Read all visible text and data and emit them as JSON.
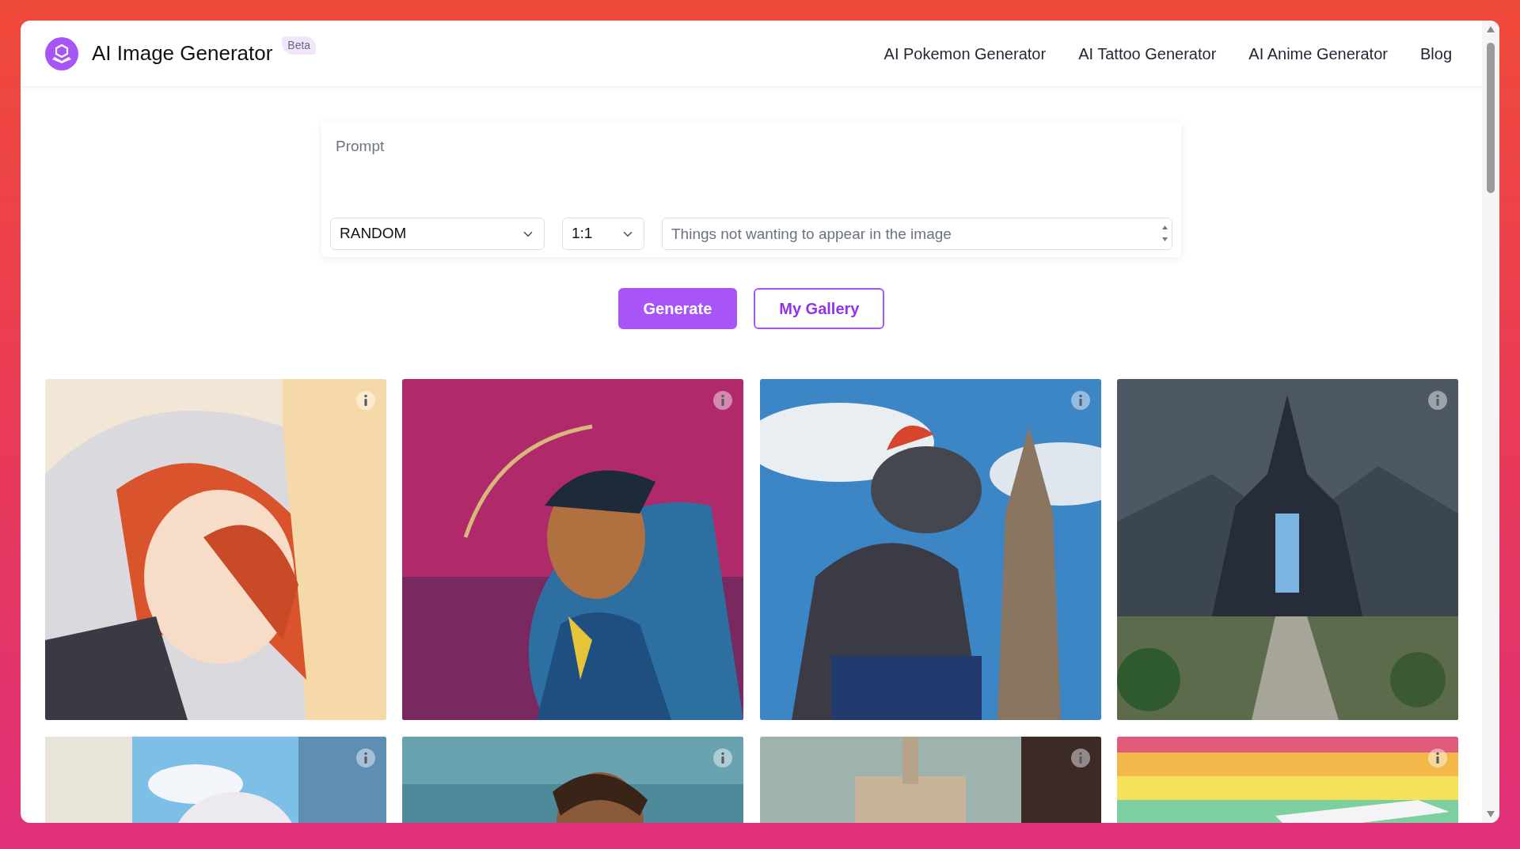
{
  "header": {
    "title": "AI Image Generator",
    "badge": "Beta",
    "nav": [
      "AI Pokemon Generator",
      "AI Tattoo Generator",
      "AI Anime Generator",
      "Blog"
    ]
  },
  "form": {
    "prompt": {
      "placeholder": "Prompt"
    },
    "style": {
      "value": "RANDOM"
    },
    "ratio": {
      "value": "1:1"
    },
    "negative": {
      "placeholder": "Things not wanting to appear in the image"
    }
  },
  "buttons": [
    {
      "label": "Generate",
      "kind": "primary"
    },
    {
      "label": "My Gallery",
      "kind": "outline"
    }
  ]
}
